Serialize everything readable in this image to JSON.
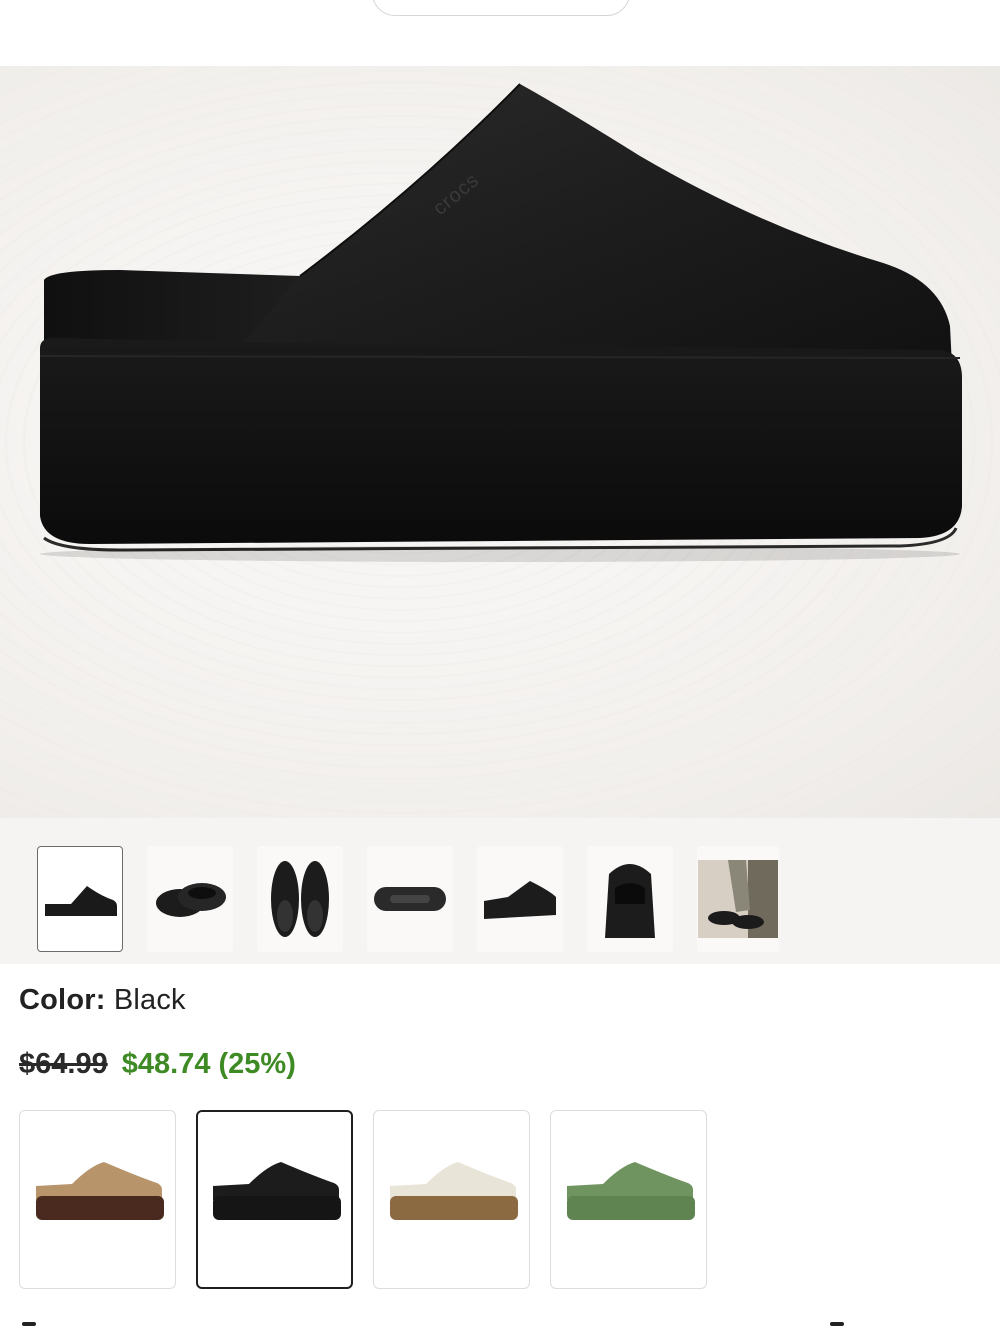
{
  "product": {
    "color_label": "Color:",
    "color_value": "Black",
    "price_original": "$64.99",
    "price_sale": "$48.74 (25%)"
  },
  "hero": {
    "image_icon": "clog-black-side-view",
    "brand_mark": "crocs"
  },
  "thumbnails": [
    {
      "icon": "clog-side-thumbnail",
      "selected": true
    },
    {
      "icon": "clog-pair-angle-thumbnail",
      "selected": false
    },
    {
      "icon": "clog-top-view-thumbnail",
      "selected": false
    },
    {
      "icon": "clog-sole-thumbnail",
      "selected": false
    },
    {
      "icon": "clog-front-angle-thumbnail",
      "selected": false
    },
    {
      "icon": "clog-back-view-thumbnail",
      "selected": false
    },
    {
      "icon": "lifestyle-photo-thumbnail",
      "selected": false
    }
  ],
  "color_swatches": [
    {
      "icon": "tan-clog-swatch",
      "color": "#b8946a",
      "sole": "#4a2a1e",
      "selected": false
    },
    {
      "icon": "black-clog-swatch",
      "color": "#1c1c1c",
      "sole": "#151515",
      "selected": true
    },
    {
      "icon": "cream-clog-swatch",
      "color": "#e8e4d8",
      "sole": "#8b6a42",
      "selected": false
    },
    {
      "icon": "green-clog-swatch",
      "color": "#6f9460",
      "sole": "#5f8452",
      "selected": false
    }
  ]
}
